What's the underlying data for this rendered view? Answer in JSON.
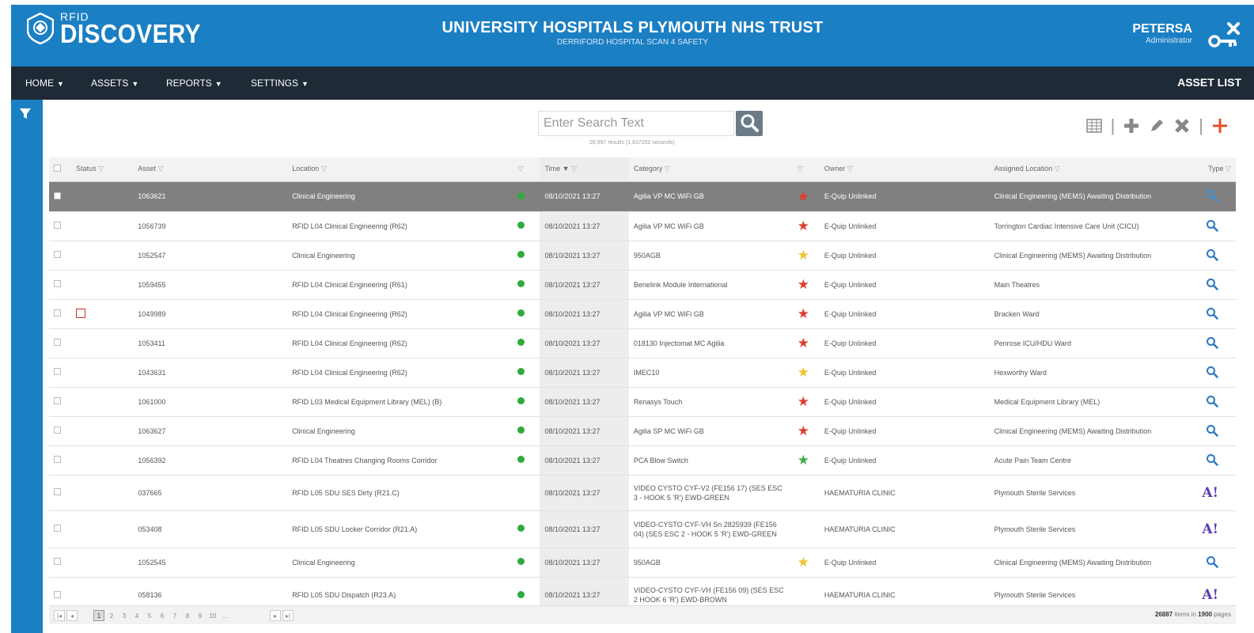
{
  "header": {
    "logo_small": "RFID",
    "logo_big": "DISCOVERY",
    "trust_name": "UNIVERSITY HOSPITALS PLYMOUTH NHS TRUST",
    "site_name": "DERRIFORD HOSPITAL SCAN 4 SAFETY",
    "user_name": "PETERSA",
    "user_role": "Administrator",
    "bg_color": "#1b7fc4"
  },
  "nav": {
    "items": [
      {
        "label": "HOME"
      },
      {
        "label": "ASSETS"
      },
      {
        "label": "REPORTS"
      },
      {
        "label": "SETTINGS"
      }
    ],
    "page_title": "ASSET LIST"
  },
  "search": {
    "placeholder": "Enter Search Text",
    "results_text": "26,597 results (1.637202 seconds)"
  },
  "table": {
    "headers": {
      "status": "Status",
      "asset": "Asset",
      "location": "Location",
      "time": "Time",
      "category": "Category",
      "owner": "Owner",
      "assigned_location": "Assigned Location",
      "type": "Type"
    },
    "rows": [
      {
        "asset": "1063621",
        "location": "Clinical Engineering",
        "time": "08/10/2021 13:27",
        "category": "Agilia VP MC WiFi GB",
        "star": "red",
        "owner": "E-Quip Unlinked",
        "assigned": "Clinical Engineering (MEMS) Awaiting Distribution",
        "type": "lens",
        "selected": true,
        "status_icon": false,
        "dot": true
      },
      {
        "asset": "1056739",
        "location": "RFID L04 Clinical Engineering (R62)",
        "time": "08/10/2021 13:27",
        "category": "Agilia VP MC WiFi GB",
        "star": "red",
        "owner": "E-Quip Unlinked",
        "assigned": "Torrington Cardiac Intensive Care Unit (CICU)",
        "type": "lens",
        "selected": false,
        "status_icon": false,
        "dot": true
      },
      {
        "asset": "1052547",
        "location": "Clinical Engineering",
        "time": "08/10/2021 13:27",
        "category": "950AGB",
        "star": "yellow",
        "owner": "E-Quip Unlinked",
        "assigned": "Clinical Engineering (MEMS) Awaiting Distribution",
        "type": "lens",
        "selected": false,
        "status_icon": false,
        "dot": true
      },
      {
        "asset": "1059455",
        "location": "RFID L04 Clinical Engineering (R61)",
        "time": "08/10/2021 13:27",
        "category": "Benelink Module International",
        "star": "red",
        "owner": "E-Quip Unlinked",
        "assigned": "Main Theatres",
        "type": "lens",
        "selected": false,
        "status_icon": false,
        "dot": true
      },
      {
        "asset": "1049989",
        "location": "RFID L04 Clinical Engineering (R62)",
        "time": "08/10/2021 13:27",
        "category": "Agilia VP MC WiFi GB",
        "star": "red",
        "owner": "E-Quip Unlinked",
        "assigned": "Bracken Ward",
        "type": "lens",
        "selected": false,
        "status_icon": true,
        "dot": true
      },
      {
        "asset": "1053411",
        "location": "RFID L04 Clinical Engineering (R62)",
        "time": "08/10/2021 13:27",
        "category": "018130 Injectomat MC Agilia",
        "star": "red",
        "owner": "E-Quip Unlinked",
        "assigned": "Penrose ICU/HDU Ward",
        "type": "lens",
        "selected": false,
        "status_icon": false,
        "dot": true
      },
      {
        "asset": "1043631",
        "location": "RFID L04 Clinical Engineering (R62)",
        "time": "08/10/2021 13:27",
        "category": "IMEC10",
        "star": "yellow",
        "owner": "E-Quip Unlinked",
        "assigned": "Hexworthy Ward",
        "type": "lens",
        "selected": false,
        "status_icon": false,
        "dot": true
      },
      {
        "asset": "1061000",
        "location": "RFID L03 Medical Equipment Library (MEL) (B)",
        "time": "08/10/2021 13:27",
        "category": "Renasys Touch",
        "star": "red",
        "owner": "E-Quip Unlinked",
        "assigned": "Medical Equipment Library (MEL)",
        "type": "lens",
        "selected": false,
        "status_icon": false,
        "dot": true
      },
      {
        "asset": "1063627",
        "location": "Clinical Engineering",
        "time": "08/10/2021 13:27",
        "category": "Agilia SP MC WiFi GB",
        "star": "red",
        "owner": "E-Quip Unlinked",
        "assigned": "Clinical Engineering (MEMS) Awaiting Distribution",
        "type": "lens",
        "selected": false,
        "status_icon": false,
        "dot": true
      },
      {
        "asset": "1056392",
        "location": "RFID L04 Theatres Changing Rooms Corridor",
        "time": "08/10/2021 13:27",
        "category": "PCA Blow Switch",
        "star": "green",
        "owner": "E-Quip Unlinked",
        "assigned": "Acute Pain Team Centre",
        "type": "lens",
        "selected": false,
        "status_icon": false,
        "dot": true
      },
      {
        "asset": "037665",
        "location": "RFID L05 SDU SES Dirty (R21.C)",
        "time": "08/10/2021 13:27",
        "category": "VIDEO CYSTO CYF-V2 (FE156 17) (SES ESC 3 - HOOK 5 'R') EWD-GREEN",
        "star": "",
        "owner": "HAEMATURIA CLINIC",
        "assigned": "Plymouth Sterile Services",
        "type": "ai",
        "selected": false,
        "status_icon": false,
        "dot": false
      },
      {
        "asset": "053408",
        "location": "RFID L05 SDU Locker Corridor (R21.A)",
        "time": "08/10/2021 13:27",
        "category": "VIDEO-CYSTO CYF-VH Sn 2825939 (FE156 04) (SES ESC 2 - HOOK 5 'R') EWD-GREEN",
        "star": "",
        "owner": "HAEMATURIA CLINIC",
        "assigned": "Plymouth Sterile Services",
        "type": "ai",
        "selected": false,
        "status_icon": false,
        "dot": true
      },
      {
        "asset": "1052545",
        "location": "Clinical Engineering",
        "time": "08/10/2021 13:27",
        "category": "950AGB",
        "star": "yellow",
        "owner": "E-Quip Unlinked",
        "assigned": "Clinical Engineering (MEMS) Awaiting Distribution",
        "type": "lens",
        "selected": false,
        "status_icon": false,
        "dot": true
      },
      {
        "asset": "058136",
        "location": "RFID L05 SDU Dispatch (R23.A)",
        "time": "08/10/2021 13:27",
        "category": "VIDEO-CYSTO CYF-VH (FE156 09) (SES ESC 2 HOOK 6 'R') EWD-BROWN",
        "star": "",
        "owner": "HAEMATURIA CLINIC",
        "assigned": "Plymouth Sterile Services",
        "type": "ai",
        "selected": false,
        "status_icon": false,
        "dot": true
      }
    ]
  },
  "pager": {
    "pages": [
      "1",
      "2",
      "3",
      "4",
      "5",
      "6",
      "7",
      "8",
      "9",
      "10",
      "..."
    ],
    "active_page": "1",
    "first": "|◂",
    "prev": "◂",
    "next": "▸",
    "last": "▸|",
    "total_items": "26887",
    "items_text": "items in",
    "total_pages": "1900",
    "pages_text": "pages"
  },
  "colors": {
    "star_red": "#e03c2c",
    "star_yellow": "#f0c330",
    "star_green": "#3fae49",
    "status_green": "#2eaa3c",
    "accent_orange": "#e0502a",
    "lens_blue": "#2a78c4",
    "nav_dark": "#1e2a36"
  }
}
